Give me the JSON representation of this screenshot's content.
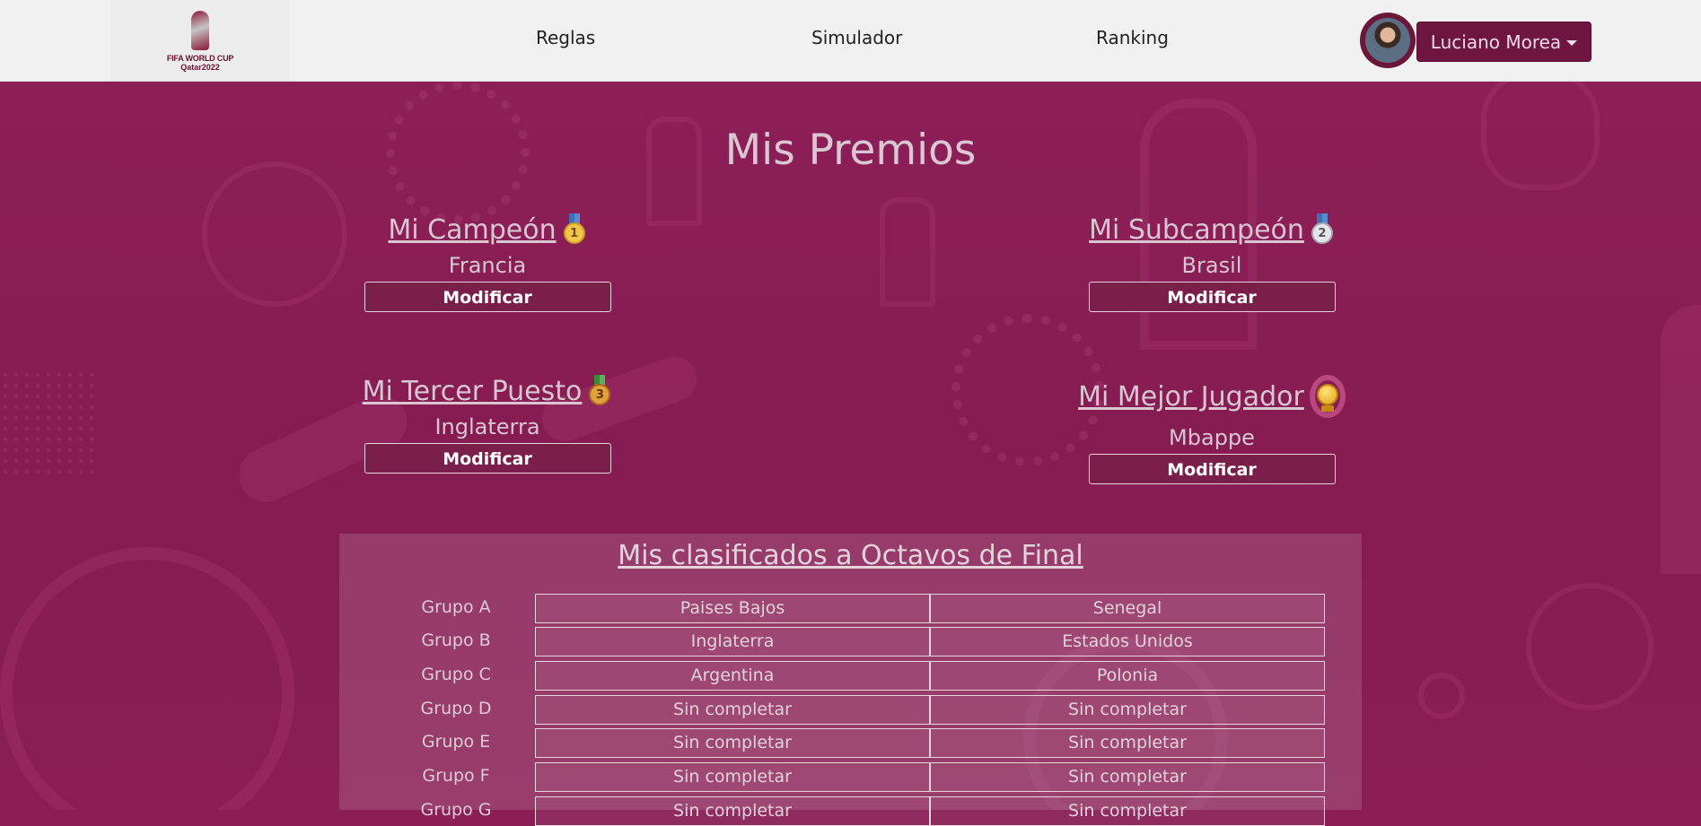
{
  "nav": {
    "logo_line1": "FIFA WORLD CUP",
    "logo_line2": "Qatar2022",
    "links": [
      "Reglas",
      "Simulador",
      "Ranking"
    ],
    "user_name": "Luciano Morea"
  },
  "page": {
    "title": "Mis Premios"
  },
  "prizes": [
    {
      "title": "Mi Campeón",
      "value": "Francia",
      "button": "Modificar",
      "icon": "gold-medal-icon"
    },
    {
      "title": "Mi Subcampeón",
      "value": "Brasil",
      "button": "Modificar",
      "icon": "silver-medal-icon"
    },
    {
      "title": "Mi Tercer Puesto",
      "value": "Inglaterra",
      "button": "Modificar",
      "icon": "bronze-medal-icon"
    },
    {
      "title": "Mi Mejor Jugador",
      "value": "Mbappe",
      "button": "Modificar",
      "icon": "golden-ball-icon"
    }
  ],
  "medal_numbers": {
    "first": "1",
    "second": "2",
    "third": "3"
  },
  "groups": {
    "title": "Mis clasificados a Octavos de Final",
    "rows": [
      {
        "label": "Grupo A",
        "first": "Paises Bajos",
        "second": "Senegal"
      },
      {
        "label": "Grupo B",
        "first": "Inglaterra",
        "second": "Estados Unidos"
      },
      {
        "label": "Grupo C",
        "first": "Argentina",
        "second": "Polonia"
      },
      {
        "label": "Grupo D",
        "first": "Sin completar",
        "second": "Sin completar"
      },
      {
        "label": "Grupo E",
        "first": "Sin completar",
        "second": "Sin completar"
      },
      {
        "label": "Grupo F",
        "first": "Sin completar",
        "second": "Sin completar"
      },
      {
        "label": "Grupo G",
        "first": "Sin completar",
        "second": "Sin completar"
      }
    ]
  },
  "colors": {
    "background": "#8a1e55",
    "navbar": "#f0f0f0",
    "accent": "#6e1640"
  }
}
